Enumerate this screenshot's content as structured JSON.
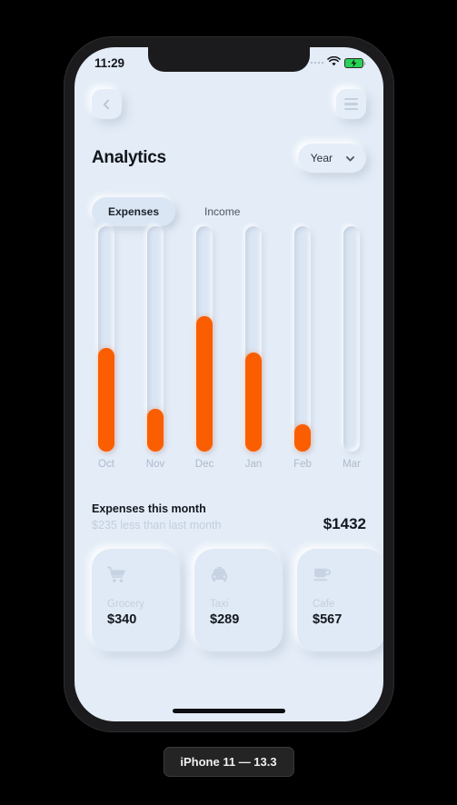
{
  "device": {
    "caption": "iPhone 11 — 13.3"
  },
  "status_bar": {
    "time": "11:29",
    "signal_icon": "signal-dots-icon",
    "wifi_icon": "wifi-icon",
    "battery_icon": "battery-charging-icon"
  },
  "top_bar": {
    "back_icon": "chevron-left-icon",
    "menu_icon": "hamburger-menu-icon"
  },
  "header": {
    "title": "Analytics",
    "range": {
      "value": "Year",
      "chevron_icon": "chevron-down-icon"
    }
  },
  "tabs": [
    {
      "label": "Expenses",
      "active": true
    },
    {
      "label": "Income",
      "active": false
    }
  ],
  "summary": {
    "title": "Expenses this month",
    "subtitle": "$235 less than last month",
    "amount": "$1432"
  },
  "cards": [
    {
      "name": "Grocery",
      "amount": "$340",
      "icon": "shopping-cart-icon"
    },
    {
      "name": "Taxi",
      "amount": "$289",
      "icon": "taxi-icon"
    },
    {
      "name": "Cafe",
      "amount": "$567",
      "icon": "coffee-cup-icon"
    }
  ],
  "colors": {
    "accent": "#fa5e00",
    "screen_bg": "#e3ecf7",
    "track": "#dbe6f4",
    "muted_text": "#c3cedd",
    "dark_text": "#14181e",
    "battery_green": "#2ad157",
    "frame": "#1b1b1d"
  },
  "chart_data": {
    "type": "bar",
    "title": "Expenses",
    "xlabel": "",
    "ylabel": "",
    "grid": false,
    "legend": "none",
    "orientation": "vertical",
    "categories": [
      "Oct",
      "Nov",
      "Dec",
      "Jan",
      "Feb",
      "Mar"
    ],
    "values": [
      46,
      19,
      60,
      44,
      12,
      0
    ],
    "ylim": [
      0,
      100
    ],
    "value_unit": "percent of track height",
    "series": [
      {
        "name": "Expenses",
        "values": [
          46,
          19,
          60,
          44,
          12,
          0
        ]
      }
    ]
  }
}
